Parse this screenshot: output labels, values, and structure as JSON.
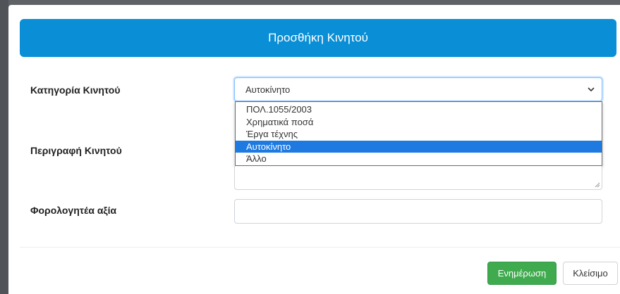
{
  "modal": {
    "title": "Προσθήκη Κινητού",
    "header_color": "#0a8fd6"
  },
  "form": {
    "category": {
      "label": "Κατηγορία Κινητού",
      "selected_value": "Αυτοκίνητο",
      "options": [
        "ΠΟΛ.1055/2003",
        "Χρηματικά ποσά",
        "Έργα τέχνης",
        "Αυτοκίνητο",
        "Άλλο"
      ],
      "highlighted_option": "Αυτοκίνητο",
      "icon": "chevron-down-icon"
    },
    "description": {
      "label": "Περιγραφή Κινητού",
      "value": ""
    },
    "taxable_value": {
      "label": "Φορολογητέα αξία",
      "value": ""
    }
  },
  "footer": {
    "update_label": "Ενημέρωση",
    "close_label": "Κλείσιμο",
    "update_color": "#3faa4e"
  }
}
